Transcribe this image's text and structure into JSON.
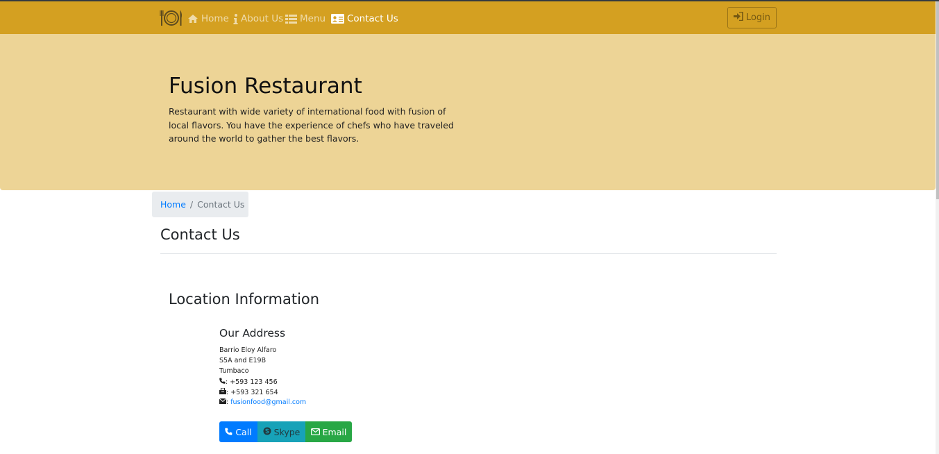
{
  "nav": {
    "brand_icon": "plate-cutlery-icon",
    "items": [
      {
        "label": "Home",
        "icon": "home-icon",
        "active": false
      },
      {
        "label": "About Us",
        "icon": "info-icon",
        "active": false
      },
      {
        "label": "Menu",
        "icon": "list-icon",
        "active": false
      },
      {
        "label": "Contact Us",
        "icon": "address-card-icon",
        "active": true
      }
    ],
    "login_label": "Login",
    "login_icon": "sign-in-icon"
  },
  "hero": {
    "title": "Fusion Restaurant",
    "text": "Restaurant with wide variety of international food with fusion of local flavors. You have the experience of chefs who have traveled around the world to gather the best flavors."
  },
  "breadcrumb": {
    "home": "Home",
    "separator": "/",
    "current": "Contact Us"
  },
  "page": {
    "title": "Contact Us"
  },
  "location": {
    "title": "Location Information",
    "address_title": "Our Address",
    "lines": [
      "Barrio Eloy Alfaro",
      "S5A and E19B",
      "Tumbaco"
    ],
    "phone": ": +593 123 456",
    "fax": ": +593 321 654",
    "email_prefix": ":",
    "email": "fusionfood@gmail.com"
  },
  "buttons": {
    "call": "Call",
    "skype": "Skype",
    "email": "Email"
  },
  "colors": {
    "navbar": "#d4a021",
    "jumbotron": "#edd496",
    "link": "#007bff",
    "call": "#007bff",
    "skype": "#17a2b8",
    "email": "#28a745"
  }
}
